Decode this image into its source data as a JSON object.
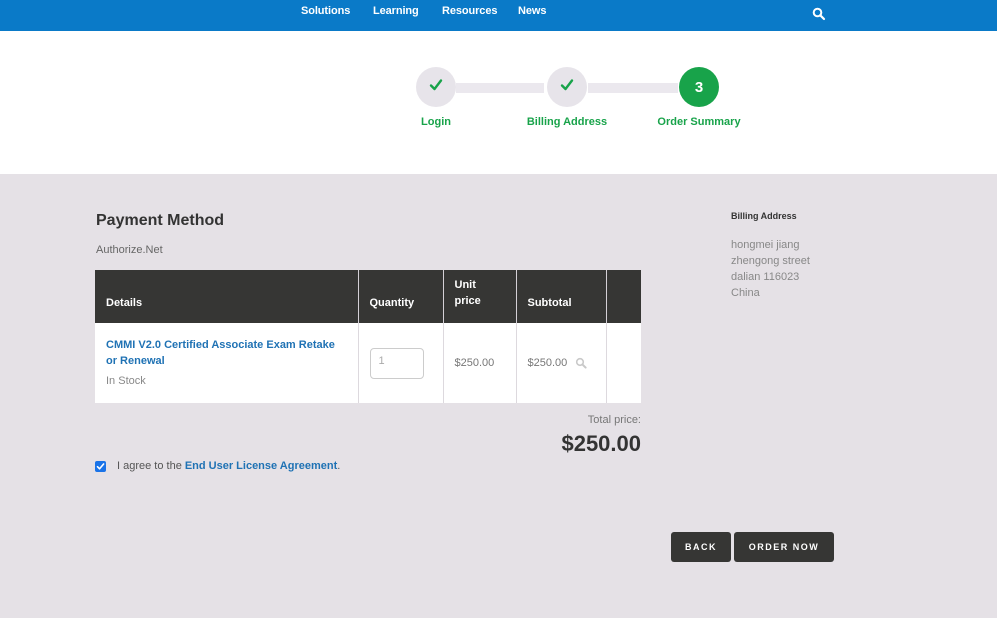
{
  "nav": {
    "items": [
      "Solutions",
      "Learning",
      "Resources",
      "News"
    ],
    "search_icon": "search-icon"
  },
  "stepper": {
    "steps": [
      {
        "label": "Login",
        "state": "complete"
      },
      {
        "label": "Billing Address",
        "state": "complete"
      },
      {
        "label": "Order Summary",
        "state": "active",
        "number": "3"
      }
    ],
    "active_color": "#18a34a",
    "pending_color": "#e7e4ea"
  },
  "payment": {
    "title": "Payment Method",
    "method": "Authorize.Net"
  },
  "cart": {
    "headers": [
      "Details",
      "Quantity",
      "Unit price",
      "Subtotal"
    ],
    "items": [
      {
        "name": "CMMI V2.0 Certified Associate Exam Retake or Renewal",
        "stock": "In Stock",
        "quantity": "1",
        "unit_price": "$250.00",
        "subtotal": "$250.00"
      }
    ]
  },
  "total": {
    "label": "Total price:",
    "value": "$250.00"
  },
  "agreement": {
    "prefix": "I agree to the",
    "link": "End User License Agreement",
    "suffix": ".",
    "checked": true
  },
  "billing": {
    "title": "Billing Address",
    "lines": [
      "hongmei jiang",
      "zhengong street",
      "dalian 116023",
      "China"
    ]
  },
  "buttons": {
    "back": "BACK",
    "order": "ORDER NOW"
  },
  "colors": {
    "nav_bg": "#0a7ac8",
    "link": "#1f72b4",
    "dark": "#363634",
    "page_bg": "#e5e1e6"
  }
}
